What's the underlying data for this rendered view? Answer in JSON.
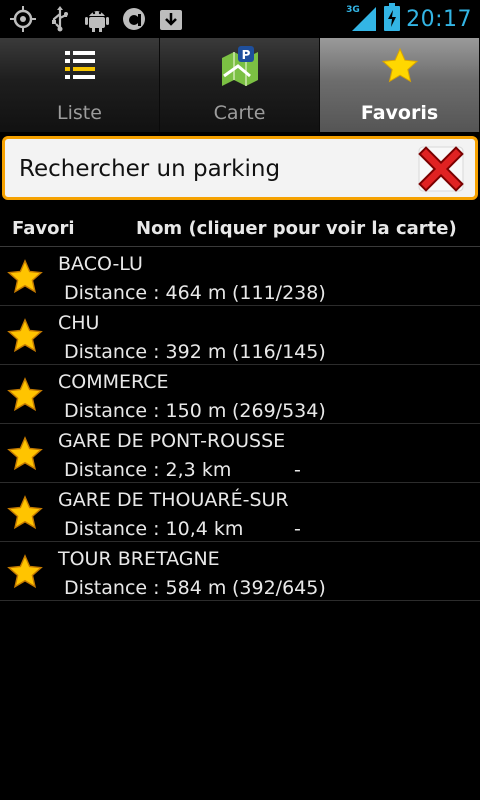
{
  "status_bar": {
    "network": "3G",
    "time": "20:17",
    "left_icons": [
      "gps-icon",
      "usb-icon",
      "android-debug-icon",
      "app-icon",
      "download-icon"
    ],
    "accent_color": "#33b5e5"
  },
  "tabs": [
    {
      "label": "Liste",
      "icon": "list-icon",
      "active": false
    },
    {
      "label": "Carte",
      "icon": "map-icon",
      "active": false
    },
    {
      "label": "Favoris",
      "icon": "star-icon",
      "active": true
    }
  ],
  "search": {
    "value": "Rechercher un parking",
    "clear_icon": "close-icon",
    "border_color": "#f5a100"
  },
  "columns": {
    "favori": "Favori",
    "nom": "Nom (cliquer pour voir la carte)"
  },
  "parkings": [
    {
      "name": "BACO-LU",
      "distance": "Distance : 464 m",
      "occupancy": "(111/238)"
    },
    {
      "name": "CHU",
      "distance": "Distance : 392 m",
      "occupancy": "(116/145)"
    },
    {
      "name": "COMMERCE",
      "distance": "Distance : 150 m",
      "occupancy": "(269/534)"
    },
    {
      "name": "GARE DE PONT-ROUSSE",
      "distance": "Distance : 2,3 km",
      "occupancy": "-"
    },
    {
      "name": "GARE DE THOUARÉ-SUR",
      "distance": "Distance : 10,4 km",
      "occupancy": "-"
    },
    {
      "name": "TOUR BRETAGNE",
      "distance": "Distance : 584 m",
      "occupancy": "(392/645)"
    }
  ]
}
